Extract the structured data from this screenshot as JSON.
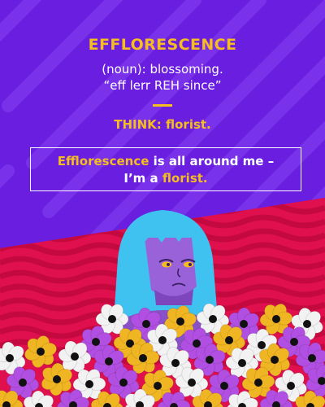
{
  "card": {
    "word": "EFFLORESCENCE",
    "definition": "(noun): blossoming.",
    "pronunciation": "“eff lerr REH since”",
    "think_prefix": "THINK: ",
    "think_word": "florist.",
    "sentence": {
      "highlight_1": "Efflorescence",
      "part_1": " is all around me –",
      "part_2": "I’m a ",
      "highlight_2": "florist."
    }
  },
  "colors": {
    "background_purple": "#6a1fe0",
    "stripe_purple": "#7b35ea",
    "wave_red": "#e0104f",
    "wave_stripe": "#c4093f",
    "accent_yellow": "#f5bd1f",
    "hair_cyan": "#3fc2f0",
    "skin_purple": "#9a62d8",
    "flower_white": "#f2f2f2",
    "flower_violet": "#b14fe2",
    "flower_gold": "#f0b522"
  },
  "illustration": {
    "character": "girl-with-blue-hair-icon",
    "flowers": "flower-field-icon"
  }
}
